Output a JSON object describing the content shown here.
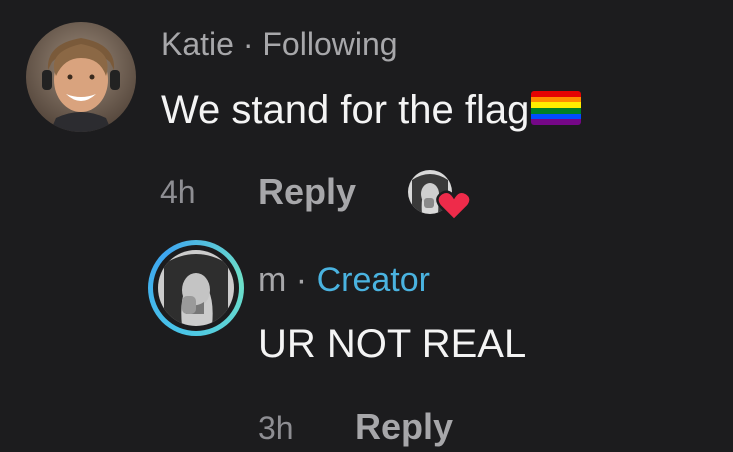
{
  "colors": {
    "background": "#1c1c1e",
    "primary_text": "#f4f4f4",
    "secondary_text": "#a7a7aa",
    "creator_badge": "#4ab3e0",
    "heart": "#ee2b4a"
  },
  "comments": [
    {
      "author": "Katie",
      "separator": "·",
      "status": "Following",
      "text": "We stand for the flag",
      "emoji": "rainbow-flag-icon",
      "time": "4h",
      "reply_label": "Reply",
      "liked_by_creator": true
    },
    {
      "author": "m",
      "separator": "·",
      "status": "Creator",
      "text": "UR NOT REAL",
      "time": "3h",
      "reply_label": "Reply"
    }
  ]
}
